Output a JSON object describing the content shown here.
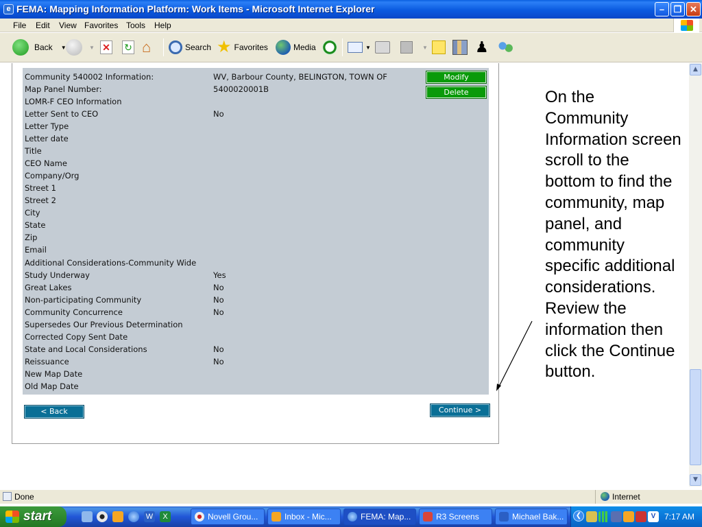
{
  "window": {
    "title": "FEMA: Mapping Information Platform: Work Items - Microsoft Internet Explorer",
    "app_icon": "ie-icon",
    "controls": [
      "minimize",
      "maximize",
      "close"
    ]
  },
  "menu": [
    "File",
    "Edit",
    "View",
    "Favorites",
    "Tools",
    "Help"
  ],
  "toolbar": {
    "back": "Back",
    "search": "Search",
    "favorites": "Favorites",
    "media": "Media"
  },
  "page": {
    "rows": [
      {
        "label": "Community 540002 Information:",
        "value": "WV, Barbour County, BELINGTON, TOWN OF"
      },
      {
        "label": "Map Panel Number:",
        "value": "5400020001B"
      },
      {
        "label": "LOMR-F CEO Information",
        "value": ""
      },
      {
        "label": "Letter Sent to CEO",
        "value": "No"
      },
      {
        "label": "Letter Type",
        "value": ""
      },
      {
        "label": "Letter date",
        "value": ""
      },
      {
        "label": "Title",
        "value": ""
      },
      {
        "label": "CEO Name",
        "value": ""
      },
      {
        "label": "Company/Org",
        "value": ""
      },
      {
        "label": "Street 1",
        "value": ""
      },
      {
        "label": "Street 2",
        "value": ""
      },
      {
        "label": "City",
        "value": ""
      },
      {
        "label": "State",
        "value": ""
      },
      {
        "label": "Zip",
        "value": ""
      },
      {
        "label": "Email",
        "value": ""
      },
      {
        "label": "Additional Considerations-Community Wide",
        "value": ""
      },
      {
        "label": "Study Underway",
        "value": "Yes"
      },
      {
        "label": "Great Lakes",
        "value": "No"
      },
      {
        "label": "Non-participating Community",
        "value": "No"
      },
      {
        "label": "Community Concurrence",
        "value": "No"
      },
      {
        "label": "Supersedes Our Previous Determination",
        "value": ""
      },
      {
        "label": "Corrected Copy Sent Date",
        "value": ""
      },
      {
        "label": "State and Local Considerations",
        "value": "No"
      },
      {
        "label": "Reissuance",
        "value": "No"
      },
      {
        "label": "New Map Date",
        "value": ""
      },
      {
        "label": "Old Map Date",
        "value": ""
      }
    ],
    "modify_label": "Modify",
    "delete_label": "Delete",
    "back_label": "< Back",
    "continue_label": "Continue >",
    "callout": "On the Community Information screen scroll to the bottom to find the community, map panel, and community specific additional considerations. Review the information then click the Continue button."
  },
  "status": {
    "text": "Done",
    "zone": "Internet"
  },
  "taskbar": {
    "start": "start",
    "tasks": [
      "Novell Grou...",
      "Inbox - Mic...",
      "FEMA: Map...",
      "R3 Screens",
      "Michael Bak..."
    ],
    "active_task": "FEMA: Map...",
    "clock": "7:17 AM"
  },
  "colors": {
    "title_bar": "#0a5ae0",
    "info_box": "#c4ccd4",
    "green_button": "#0a9a0a",
    "blue_button": "#0a6f96",
    "taskbar": "#2157d7",
    "start_button": "#2f8a2f"
  }
}
